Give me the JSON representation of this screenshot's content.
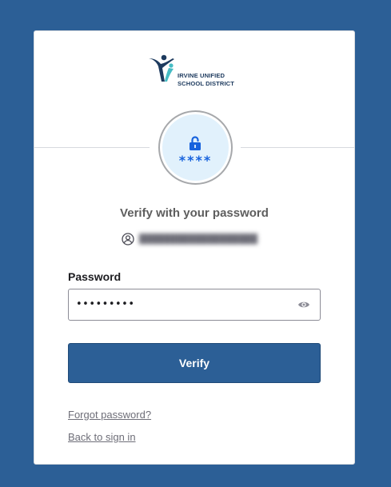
{
  "brand": {
    "line1": "IRVINE UNIFIED",
    "line2": "SCHOOL DISTRICT",
    "colors": {
      "navy": "#1d3a5e",
      "teal": "#46bcc4",
      "background": "#2c5f96"
    }
  },
  "authenticator": {
    "icon": "lock-open-icon",
    "mask": "****",
    "accent": "#1662dd"
  },
  "title": "Verify with your password",
  "identifier": {
    "icon": "user-circle-icon",
    "value": "███████████████████"
  },
  "password": {
    "label": "Password",
    "value": "•••••••••",
    "toggle_icon": "eye-icon"
  },
  "actions": {
    "verify_label": "Verify",
    "forgot_label": "Forgot password?",
    "back_label": "Back to sign in"
  }
}
